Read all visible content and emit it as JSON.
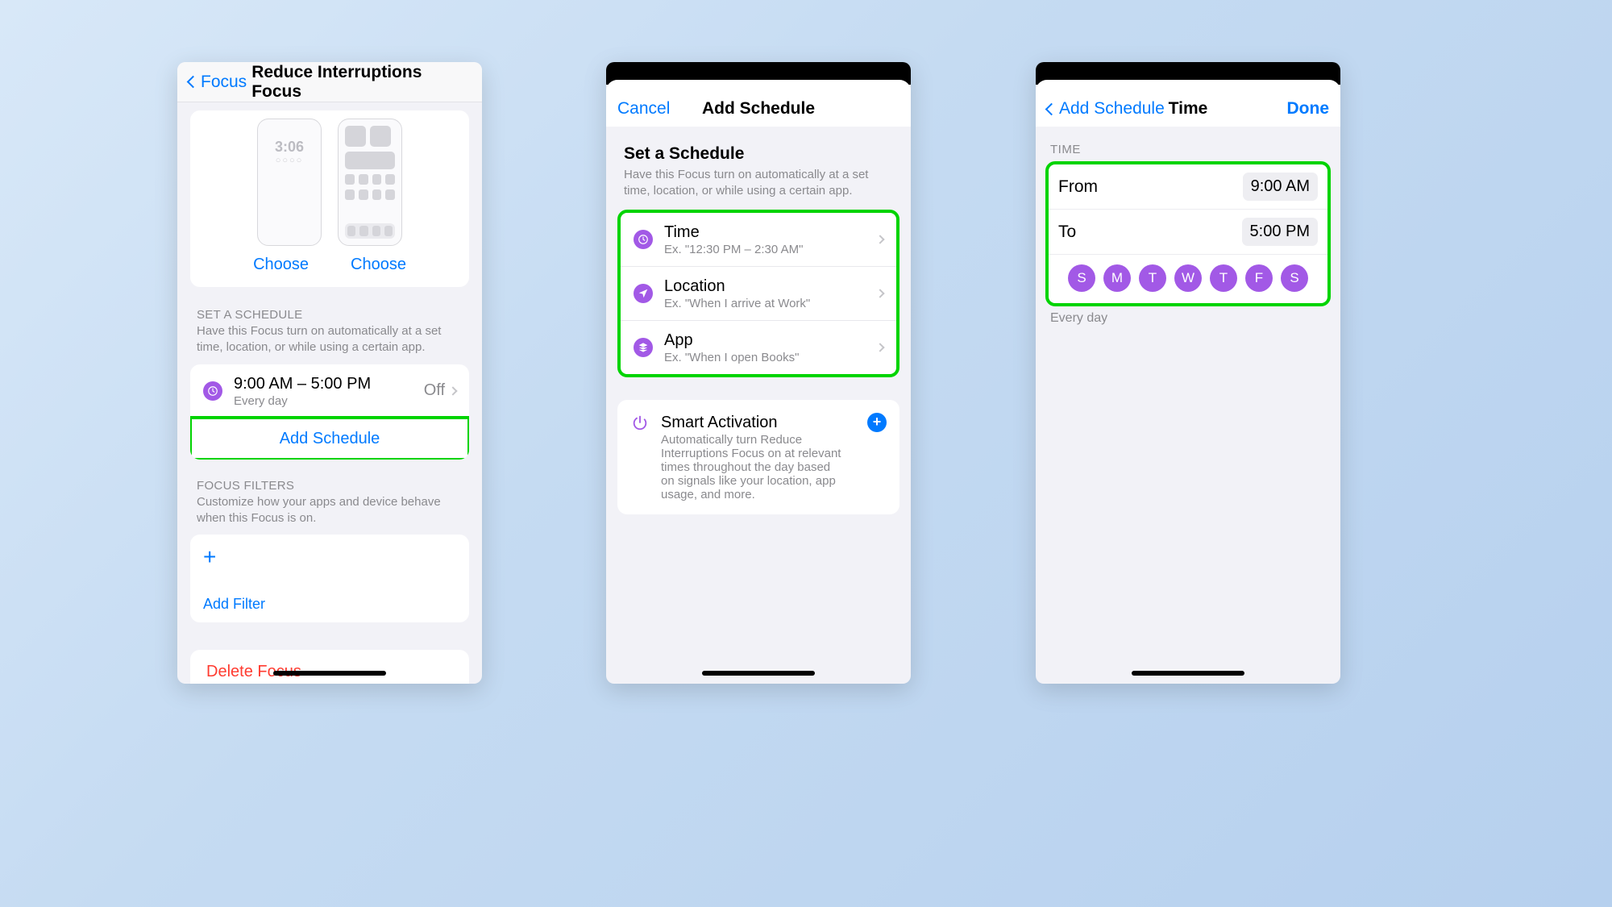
{
  "phoneA": {
    "back": "Focus",
    "title": "Reduce Interruptions Focus",
    "preview_clock": "3:06",
    "choose": "Choose",
    "sched_header": "SET A SCHEDULE",
    "sched_desc": "Have this Focus turn on automatically at a set time, location, or while using a certain app.",
    "sched_time": "9:00 AM – 5:00 PM",
    "sched_sub": "Every day",
    "sched_trail": "Off",
    "add_schedule": "Add Schedule",
    "filters_header": "FOCUS FILTERS",
    "filters_desc": "Customize how your apps and device behave when this Focus is on.",
    "add_filter": "Add Filter",
    "delete": "Delete Focus"
  },
  "phoneB": {
    "cancel": "Cancel",
    "title": "Add Schedule",
    "head": "Set a Schedule",
    "desc": "Have this Focus turn on automatically at a set time, location, or while using a certain app.",
    "rows": [
      {
        "title": "Time",
        "sub": "Ex. \"12:30 PM – 2:30 AM\""
      },
      {
        "title": "Location",
        "sub": "Ex. \"When I arrive at Work\""
      },
      {
        "title": "App",
        "sub": "Ex. \"When I open Books\""
      }
    ],
    "smart_title": "Smart Activation",
    "smart_desc": "Automatically turn Reduce Interruptions Focus on at relevant times throughout the day based on signals like your location, app usage, and more."
  },
  "phoneC": {
    "back": "Add Schedule",
    "title": "Time",
    "done": "Done",
    "section": "TIME",
    "from_label": "From",
    "from_val": "9:00 AM",
    "to_label": "To",
    "to_val": "5:00 PM",
    "days": [
      "S",
      "M",
      "T",
      "W",
      "T",
      "F",
      "S"
    ],
    "caption": "Every day"
  }
}
